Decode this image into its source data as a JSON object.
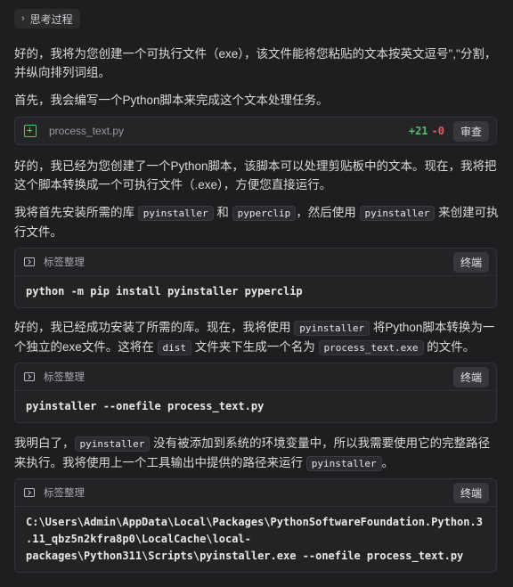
{
  "thinking": {
    "label": "思考过程"
  },
  "p1": "好的，我将为您创建一个可执行文件（exe），该文件能将您粘贴的文本按英文逗号\",\"分割，并纵向排列词组。",
  "p2": "首先，我会编写一个Python脚本来完成这个文本处理任务。",
  "file_card": {
    "name": "process_text.py",
    "added": "+21",
    "removed": "-0",
    "review_label": "审查"
  },
  "p3": "好的，我已经为您创建了一个Python脚本，该脚本可以处理剪贴板中的文本。现在，我将把这个脚本转换成一个可执行文件（.exe），方便您直接运行。",
  "p4": {
    "t1": "我将首先安装所需的库 ",
    "c1": "pyinstaller",
    "t2": " 和 ",
    "c2": "pyperclip",
    "t3": "，然后使用 ",
    "c3": "pyinstaller",
    "t4": " 来创建可执行文件。"
  },
  "code1": {
    "lang": "标签整理",
    "action": "终端",
    "code": "python -m pip install pyinstaller pyperclip"
  },
  "p5": {
    "t1": "好的，我已经成功安装了所需的库。现在，我将使用 ",
    "c1": "pyinstaller",
    "t2": " 将Python脚本转换为一个独立的exe文件。这将在 ",
    "c2": "dist",
    "t3": " 文件夹下生成一个名为 ",
    "c3": "process_text.exe",
    "t4": " 的文件。"
  },
  "code2": {
    "lang": "标签整理",
    "action": "终端",
    "code": "pyinstaller --onefile process_text.py"
  },
  "p6": {
    "t1": "我明白了，",
    "c1": "pyinstaller",
    "t2": " 没有被添加到系统的环境变量中，所以我需要使用它的完整路径来执行。我将使用上一个工具输出中提供的路径来运行 ",
    "c2": "pyinstaller",
    "t3": "。"
  },
  "code3": {
    "lang": "标签整理",
    "action": "终端",
    "code": "C:\\Users\\Admin\\AppData\\Local\\Packages\\PythonSoftwareFoundation.Python.3\n.11_qbz5n2kfra8p0\\LocalCache\\local-\npackages\\Python311\\Scripts\\pyinstaller.exe --onefile process_text.py"
  }
}
